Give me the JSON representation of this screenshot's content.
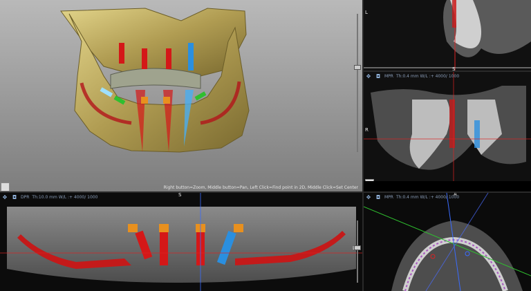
{
  "hint_bar": {
    "text": "Right button=Zoom, Middle button=Pan, Left Click=Find point in 2D, Middle Click=Set Center"
  },
  "panoramic_view": {
    "label": "DPR",
    "params": "Th:10.0 mm   W/L :+ 4000/ 1000"
  },
  "mpr_view": {
    "label": "MPR",
    "params": "Th:0.4 mm   W/L :+ 4000/ 1000"
  },
  "axial_view": {
    "label": "MPR",
    "params": "Th:0.4 mm   W/L :+ 4000/ 1000"
  },
  "orientation": {
    "top_right_L": "L",
    "top_right_S": "S",
    "mid_right_R": "R",
    "pan_S": "S",
    "pan_LR": "L R",
    "axial_A": "A",
    "axial_I": "I"
  },
  "icons": {
    "move": "move-icon",
    "camera": "camera-icon",
    "avatar": "avatar-icon"
  },
  "colors": {
    "implant_red": "#c41a1a",
    "implant_blue": "#2a8fe0",
    "abutment_orange": "#e8901e",
    "nerve_red": "#b3141a",
    "bone": "#b9a65c",
    "crosshair_red": "#d22",
    "crosshair_blue": "#3a6cff",
    "crosshair_green": "#2fbf2f"
  }
}
